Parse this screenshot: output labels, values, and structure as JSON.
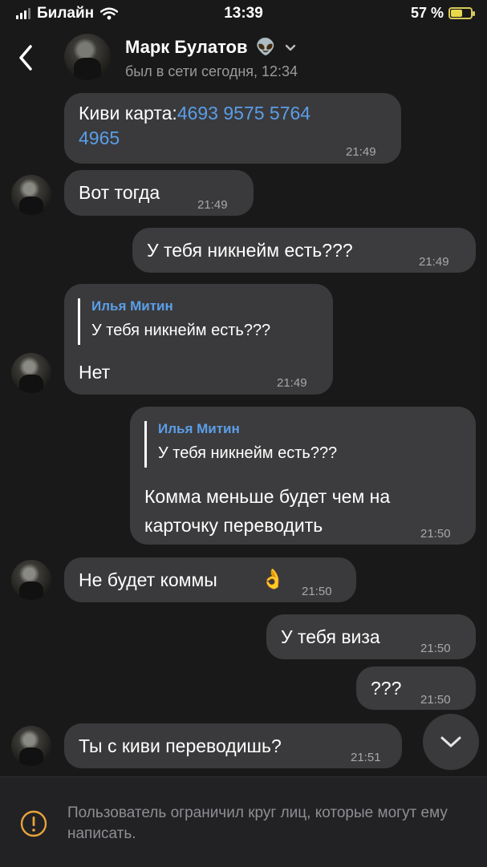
{
  "status": {
    "carrier": "Билайн",
    "time": "13:39",
    "battery": "57 %"
  },
  "header": {
    "name": "Марк Булатов",
    "emoji": "👽",
    "last_seen": "был в сети сегодня, 12:34"
  },
  "messages": [
    {
      "prefix": "Киви карта:",
      "card_line1": "4693 9575 5764",
      "card_line2": "4965",
      "time": "21:49"
    },
    {
      "text": "Вот тогда",
      "time": "21:49"
    },
    {
      "text": "У тебя никнейм есть???",
      "time": "21:49"
    },
    {
      "reply_name": "Илья Митин",
      "reply_text": "У тебя никнейм есть???",
      "text": "Нет",
      "time": "21:49"
    },
    {
      "reply_name": "Илья Митин",
      "reply_text": "У тебя никнейм есть???",
      "line1": "Комма меньше будет чем на",
      "line2": "карточку переводить",
      "time": "21:50"
    },
    {
      "text": "Не будет коммы",
      "emoji": "👌",
      "time": "21:50"
    },
    {
      "text": "У тебя виза",
      "time": "21:50"
    },
    {
      "text": "???",
      "time": "21:50"
    },
    {
      "text": "Ты с киви переводишь?",
      "time": "21:51"
    }
  ],
  "footer": {
    "notice": "Пользователь ограничил круг лиц, которые могут ему написать."
  }
}
